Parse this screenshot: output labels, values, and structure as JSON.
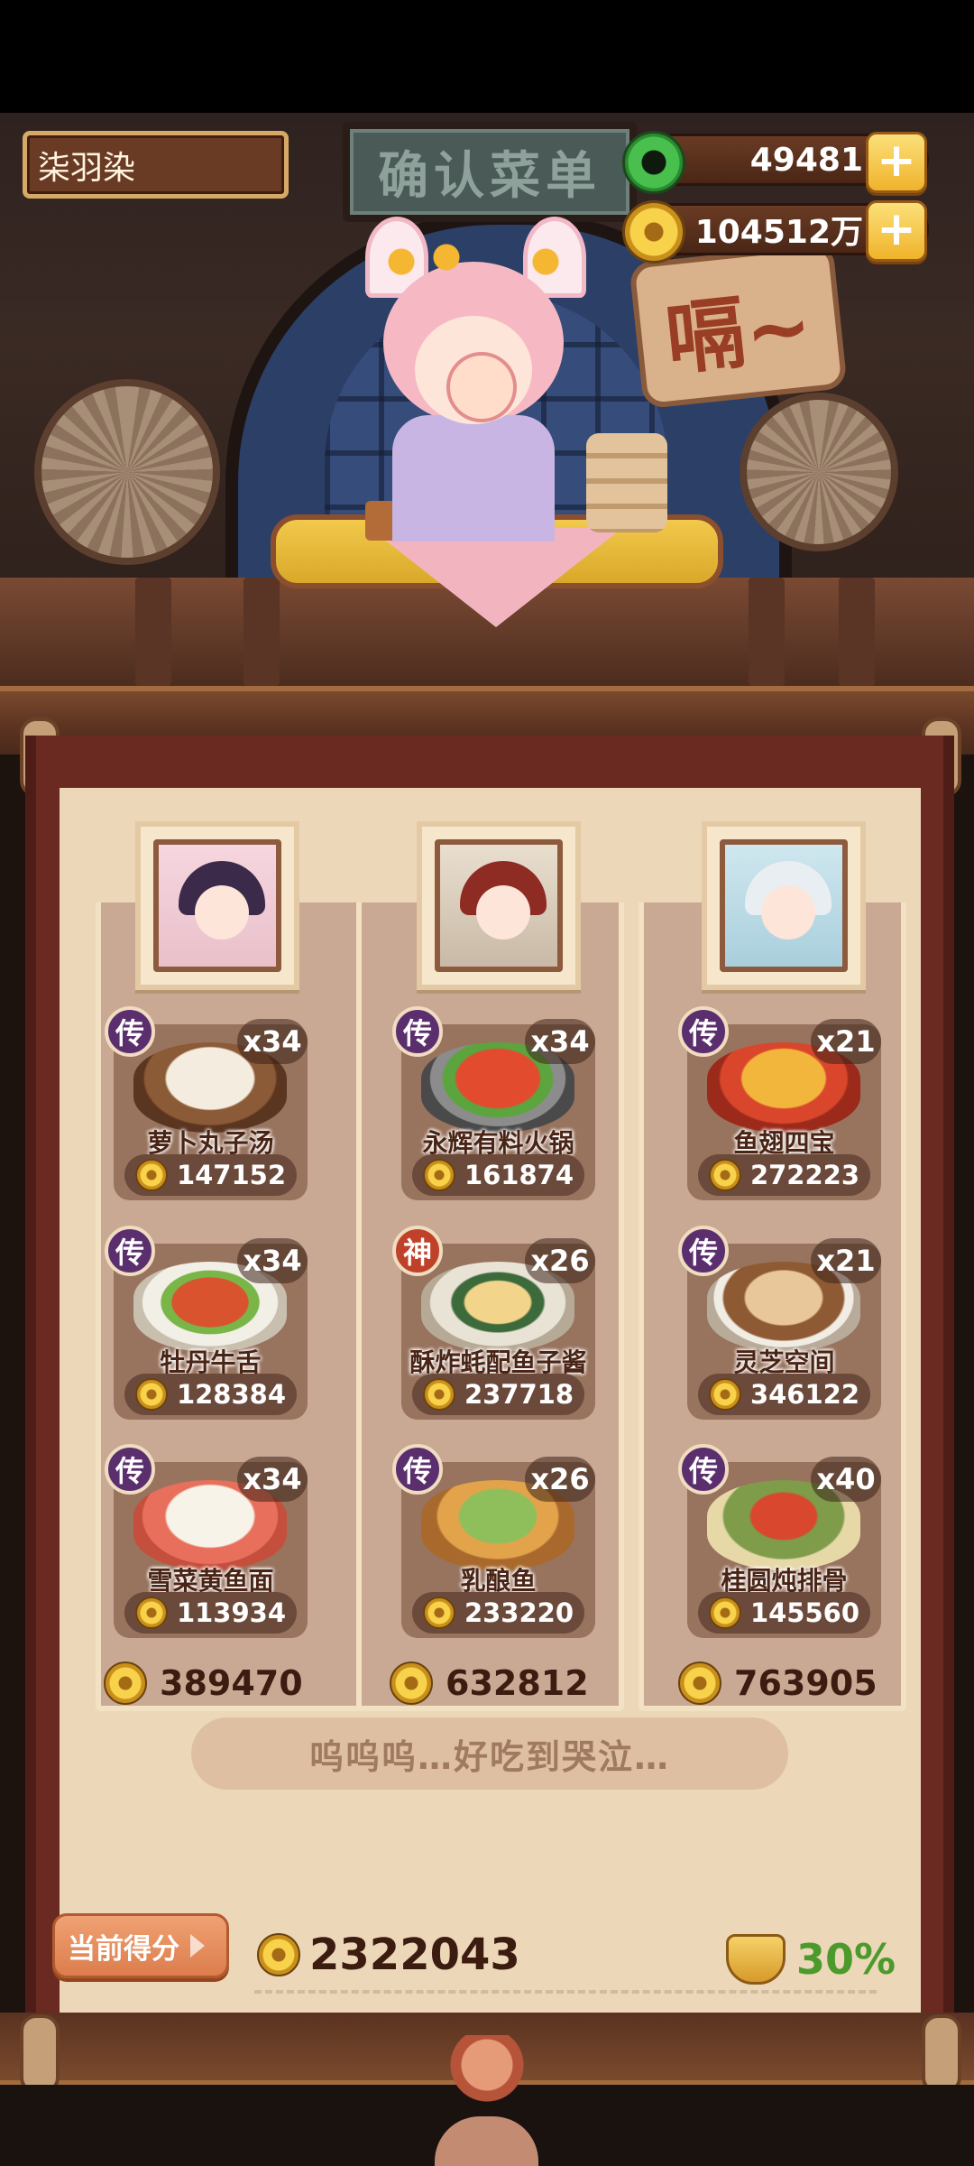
{
  "header": {
    "player_name": "柒羽染",
    "sign_text": "确认菜单",
    "jade_amount": "49481",
    "coin_amount": "104512万",
    "add_label": "+"
  },
  "speech": {
    "text": "嗝~"
  },
  "columns": [
    {
      "dishes": [
        {
          "tier": "传",
          "count": "x34",
          "name": "萝卜丸子汤",
          "price": "147152"
        },
        {
          "tier": "传",
          "count": "x34",
          "name": "牡丹牛舌",
          "price": "128384"
        },
        {
          "tier": "传",
          "count": "x34",
          "name": "雪菜黄鱼面",
          "price": "113934"
        }
      ],
      "total": "389470"
    },
    {
      "dishes": [
        {
          "tier": "传",
          "count": "x34",
          "name": "永辉有料火锅",
          "price": "161874"
        },
        {
          "tier": "神",
          "count": "x26",
          "name": "酥炸蚝配鱼子酱",
          "price": "237718"
        },
        {
          "tier": "传",
          "count": "x26",
          "name": "乳酿鱼",
          "price": "233220"
        }
      ],
      "total": "632812"
    },
    {
      "dishes": [
        {
          "tier": "传",
          "count": "x21",
          "name": "鱼翅四宝",
          "price": "272223"
        },
        {
          "tier": "传",
          "count": "x21",
          "name": "灵芝空间",
          "price": "346122"
        },
        {
          "tier": "传",
          "count": "x40",
          "name": "桂圆炖排骨",
          "price": "145560"
        }
      ],
      "total": "763905"
    }
  ],
  "comment": "呜呜呜…好吃到哭泣…",
  "footer": {
    "score_button": "当前得分",
    "total_score": "2322043",
    "percent": "30%"
  },
  "colors": {
    "tier_legend": "#5b2f6e",
    "tier_god": "#c0412a",
    "percent_green": "#4d9a2c",
    "score_button": "#dc7d4d"
  }
}
